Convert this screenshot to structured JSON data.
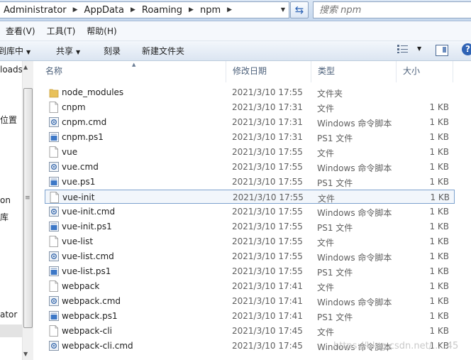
{
  "address": {
    "breadcrumbs": [
      "Administrator",
      "AppData",
      "Roaming",
      "npm"
    ],
    "search_placeholder": "搜索 npm"
  },
  "menubar": [
    "查看(V)",
    "工具(T)",
    "帮助(H)"
  ],
  "toolbar": {
    "include_library": "到库中",
    "share": "共享",
    "burn": "刻录",
    "new_folder": "新建文件夹"
  },
  "navpane": {
    "items": [
      "loads",
      "位置",
      "on",
      "库",
      "ator"
    ]
  },
  "columns": {
    "name": "名称",
    "date": "修改日期",
    "type": "类型",
    "size": "大小"
  },
  "files": [
    {
      "name": "node_modules",
      "date": "2021/3/10 17:55",
      "type": "文件夹",
      "size": "",
      "icon": "folder-icon"
    },
    {
      "name": "cnpm",
      "date": "2021/3/10 17:31",
      "type": "文件",
      "size": "1 KB",
      "icon": "file-icon"
    },
    {
      "name": "cnpm.cmd",
      "date": "2021/3/10 17:31",
      "type": "Windows 命令脚本",
      "size": "1 KB",
      "icon": "cmd-script-icon"
    },
    {
      "name": "cnpm.ps1",
      "date": "2021/3/10 17:31",
      "type": "PS1 文件",
      "size": "1 KB",
      "icon": "ps1-file-icon"
    },
    {
      "name": "vue",
      "date": "2021/3/10 17:55",
      "type": "文件",
      "size": "1 KB",
      "icon": "file-icon"
    },
    {
      "name": "vue.cmd",
      "date": "2021/3/10 17:55",
      "type": "Windows 命令脚本",
      "size": "1 KB",
      "icon": "cmd-script-icon"
    },
    {
      "name": "vue.ps1",
      "date": "2021/3/10 17:55",
      "type": "PS1 文件",
      "size": "1 KB",
      "icon": "ps1-file-icon"
    },
    {
      "name": "vue-init",
      "date": "2021/3/10 17:55",
      "type": "文件",
      "size": "1 KB",
      "icon": "file-icon",
      "selected": true
    },
    {
      "name": "vue-init.cmd",
      "date": "2021/3/10 17:55",
      "type": "Windows 命令脚本",
      "size": "1 KB",
      "icon": "cmd-script-icon"
    },
    {
      "name": "vue-init.ps1",
      "date": "2021/3/10 17:55",
      "type": "PS1 文件",
      "size": "1 KB",
      "icon": "ps1-file-icon"
    },
    {
      "name": "vue-list",
      "date": "2021/3/10 17:55",
      "type": "文件",
      "size": "1 KB",
      "icon": "file-icon"
    },
    {
      "name": "vue-list.cmd",
      "date": "2021/3/10 17:55",
      "type": "Windows 命令脚本",
      "size": "1 KB",
      "icon": "cmd-script-icon"
    },
    {
      "name": "vue-list.ps1",
      "date": "2021/3/10 17:55",
      "type": "PS1 文件",
      "size": "1 KB",
      "icon": "ps1-file-icon"
    },
    {
      "name": "webpack",
      "date": "2021/3/10 17:41",
      "type": "文件",
      "size": "1 KB",
      "icon": "file-icon"
    },
    {
      "name": "webpack.cmd",
      "date": "2021/3/10 17:41",
      "type": "Windows 命令脚本",
      "size": "1 KB",
      "icon": "cmd-script-icon"
    },
    {
      "name": "webpack.ps1",
      "date": "2021/3/10 17:41",
      "type": "PS1 文件",
      "size": "1 KB",
      "icon": "ps1-file-icon"
    },
    {
      "name": "webpack-cli",
      "date": "2021/3/10 17:45",
      "type": "文件",
      "size": "1 KB",
      "icon": "file-icon"
    },
    {
      "name": "webpack-cli.cmd",
      "date": "2021/3/10 17:45",
      "type": "Windows 命令脚本",
      "size": "1 KB",
      "icon": "cmd-script-icon"
    }
  ],
  "watermark": "https://blog.csdn.net/.....45"
}
